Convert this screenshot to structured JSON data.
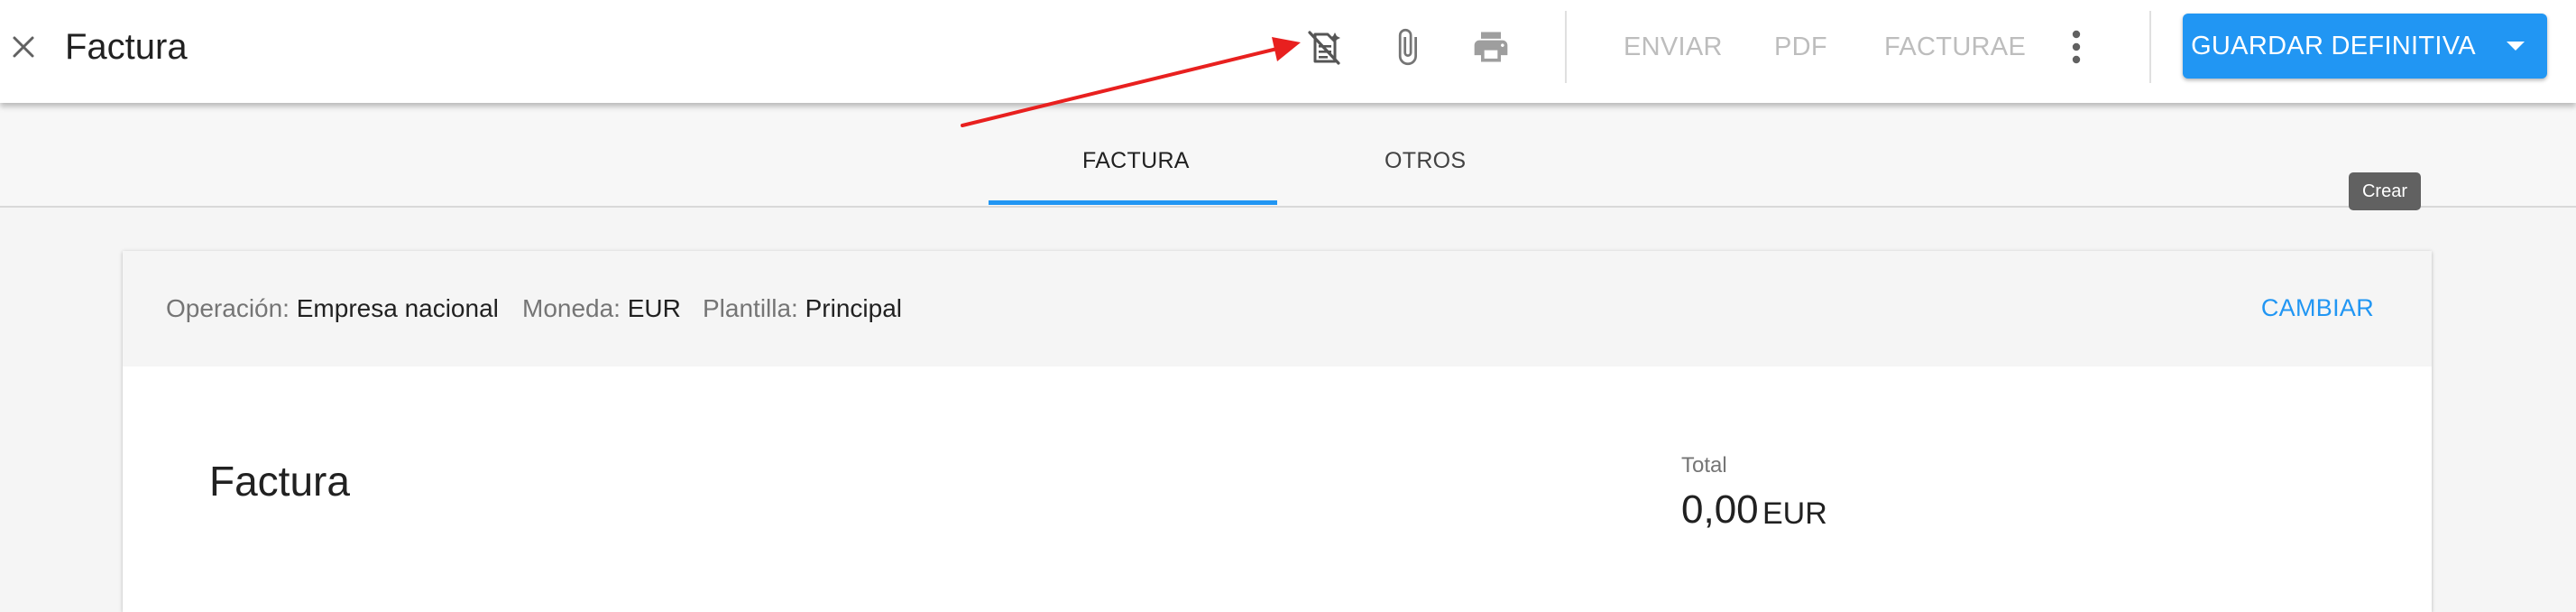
{
  "header": {
    "title": "Factura",
    "close_icon": "close-icon",
    "icons": [
      "ai-scan-off-icon",
      "paperclip-icon",
      "printer-icon"
    ],
    "actions": {
      "send": "ENVIAR",
      "pdf": "PDF",
      "facturae": "FACTURAE"
    },
    "more_icon": "more-vertical-icon",
    "save_label": "GUARDAR DEFINITIVA",
    "save_dropdown_icon": "chevron-down-icon"
  },
  "tabs": [
    {
      "label": "FACTURA",
      "active": true
    },
    {
      "label": "OTROS",
      "active": false
    }
  ],
  "tooltip": "Crear",
  "card": {
    "operation_label": "Operación:",
    "operation_value": "Empresa nacional",
    "currency_label": "Moneda:",
    "currency_value": "EUR",
    "template_label": "Plantilla:",
    "template_value": "Principal",
    "change_label": "CAMBIAR"
  },
  "document": {
    "title": "Factura",
    "total_label": "Total",
    "total_amount": "0,00",
    "total_currency": "EUR"
  },
  "colors": {
    "accent": "#2196f3",
    "annotation_arrow": "#e8201f",
    "disabled_text": "#bdbdbd",
    "tooltip_bg": "#616161"
  }
}
